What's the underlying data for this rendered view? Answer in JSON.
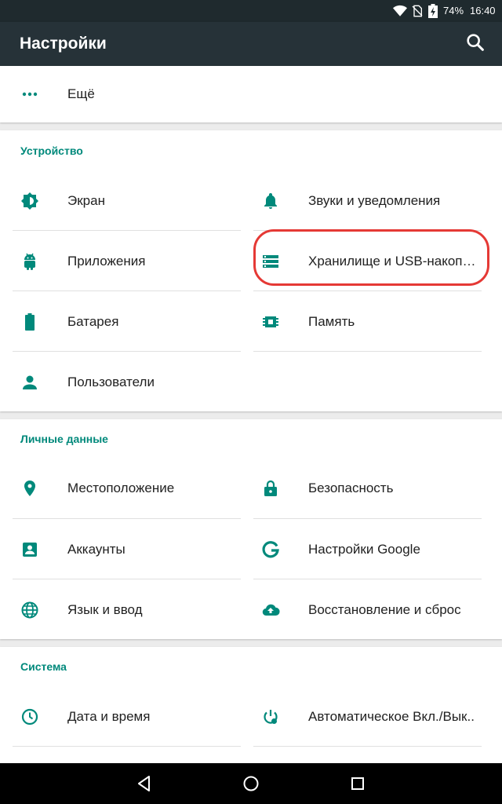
{
  "status_bar": {
    "battery": "74%",
    "time": "16:40"
  },
  "app_bar": {
    "title": "Настройки"
  },
  "more": {
    "label": "Ещё"
  },
  "sections": {
    "device": {
      "title": "Устройство",
      "items": [
        {
          "label": "Экран",
          "icon": "brightness-icon"
        },
        {
          "label": "Звуки и уведомления",
          "icon": "bell-icon"
        },
        {
          "label": "Приложения",
          "icon": "android-icon"
        },
        {
          "label": "Хранилище и USB-накопит..",
          "icon": "storage-icon"
        },
        {
          "label": "Батарея",
          "icon": "battery-icon"
        },
        {
          "label": "Память",
          "icon": "memory-icon"
        },
        {
          "label": "Пользователи",
          "icon": "person-icon"
        }
      ]
    },
    "personal": {
      "title": "Личные данные",
      "items": [
        {
          "label": "Местоположение",
          "icon": "location-icon"
        },
        {
          "label": "Безопасность",
          "icon": "lock-icon"
        },
        {
          "label": "Аккаунты",
          "icon": "account-icon"
        },
        {
          "label": "Настройки Google",
          "icon": "google-icon"
        },
        {
          "label": "Язык и ввод",
          "icon": "globe-icon"
        },
        {
          "label": "Восстановление и сброс",
          "icon": "cloud-upload-icon"
        }
      ]
    },
    "system": {
      "title": "Система",
      "items": [
        {
          "label": "Дата и время",
          "icon": "clock-icon"
        },
        {
          "label": "Автоматическое Вкл./Вык..",
          "icon": "power-schedule-icon"
        }
      ]
    }
  },
  "colors": {
    "accent": "#00897b",
    "app_bar": "#263238",
    "highlight": "#e53935"
  }
}
